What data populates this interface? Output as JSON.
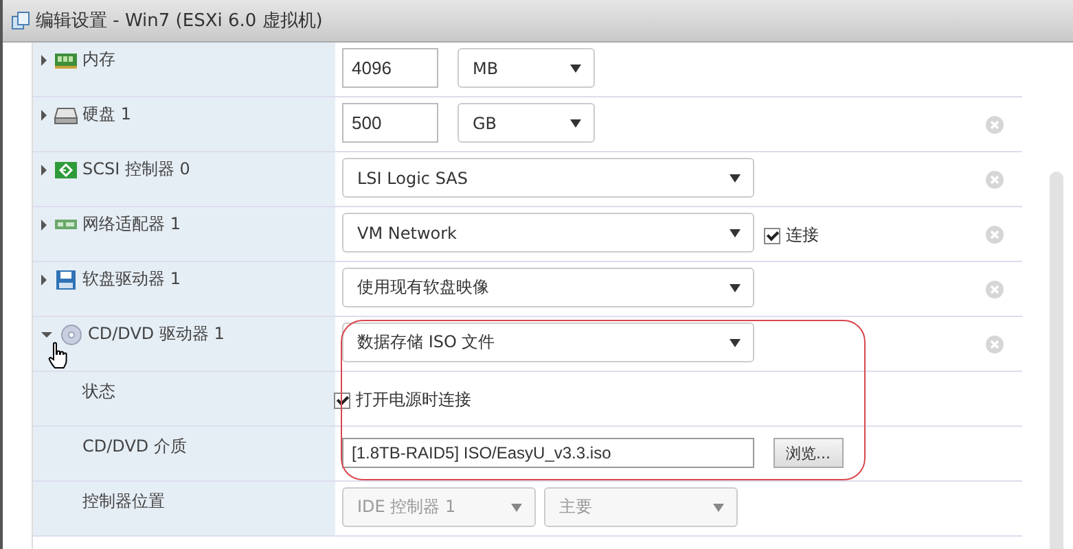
{
  "window": {
    "title": "编辑设置 - Win7 (ESXi 6.0 虚拟机)"
  },
  "rows": [
    {
      "kind": "memory",
      "label": "内存",
      "expanded": false,
      "removable": false,
      "highlighted": false,
      "controls": [
        {
          "kind": "input",
          "value": "4096"
        },
        {
          "kind": "select",
          "value": "MB",
          "disabled": false
        }
      ]
    },
    {
      "kind": "disk",
      "label": "硬盘 1",
      "expanded": false,
      "removable": true,
      "highlighted": false,
      "controls": [
        {
          "kind": "input",
          "value": "500"
        },
        {
          "kind": "select",
          "value": "GB",
          "disabled": false
        }
      ]
    },
    {
      "kind": "scsi",
      "label": "SCSI 控制器 0",
      "expanded": false,
      "removable": true,
      "highlighted": false,
      "controls": [
        {
          "kind": "select",
          "value": "LSI Logic SAS",
          "disabled": false
        }
      ]
    },
    {
      "kind": "network",
      "label": "网络适配器 1",
      "expanded": false,
      "removable": true,
      "highlighted": false,
      "controls": [
        {
          "kind": "select",
          "value": "VM Network",
          "disabled": false
        },
        {
          "kind": "checkbox",
          "label": "连接",
          "checked": true
        }
      ]
    },
    {
      "kind": "floppy",
      "label": "软盘驱动器 1",
      "expanded": false,
      "removable": true,
      "highlighted": false,
      "controls": [
        {
          "kind": "select",
          "value": "使用现有软盘映像",
          "disabled": false
        }
      ]
    },
    {
      "kind": "cdrom",
      "label": "CD/DVD 驱动器 1",
      "expanded": true,
      "removable": true,
      "highlighted": true,
      "controls": [
        {
          "kind": "select",
          "value": "数据存储 ISO 文件",
          "disabled": false
        }
      ]
    },
    {
      "kind": "property",
      "label": "状态",
      "removable": false,
      "highlighted": true,
      "controls": [
        {
          "kind": "checkbox",
          "label": "打开电源时连接",
          "checked": true
        }
      ]
    },
    {
      "kind": "property",
      "label": "CD/DVD 介质",
      "removable": false,
      "highlighted": true,
      "controls": [
        {
          "kind": "file",
          "value": "[1.8TB-RAID5] ISO/EasyU_v3.3.iso"
        },
        {
          "kind": "button",
          "label": "浏览..."
        }
      ]
    },
    {
      "kind": "property",
      "label": "控制器位置",
      "removable": false,
      "highlighted": false,
      "controls": [
        {
          "kind": "select",
          "value": "IDE 控制器 1",
          "disabled": true
        },
        {
          "kind": "select",
          "value": "主要",
          "disabled": true
        }
      ]
    }
  ]
}
